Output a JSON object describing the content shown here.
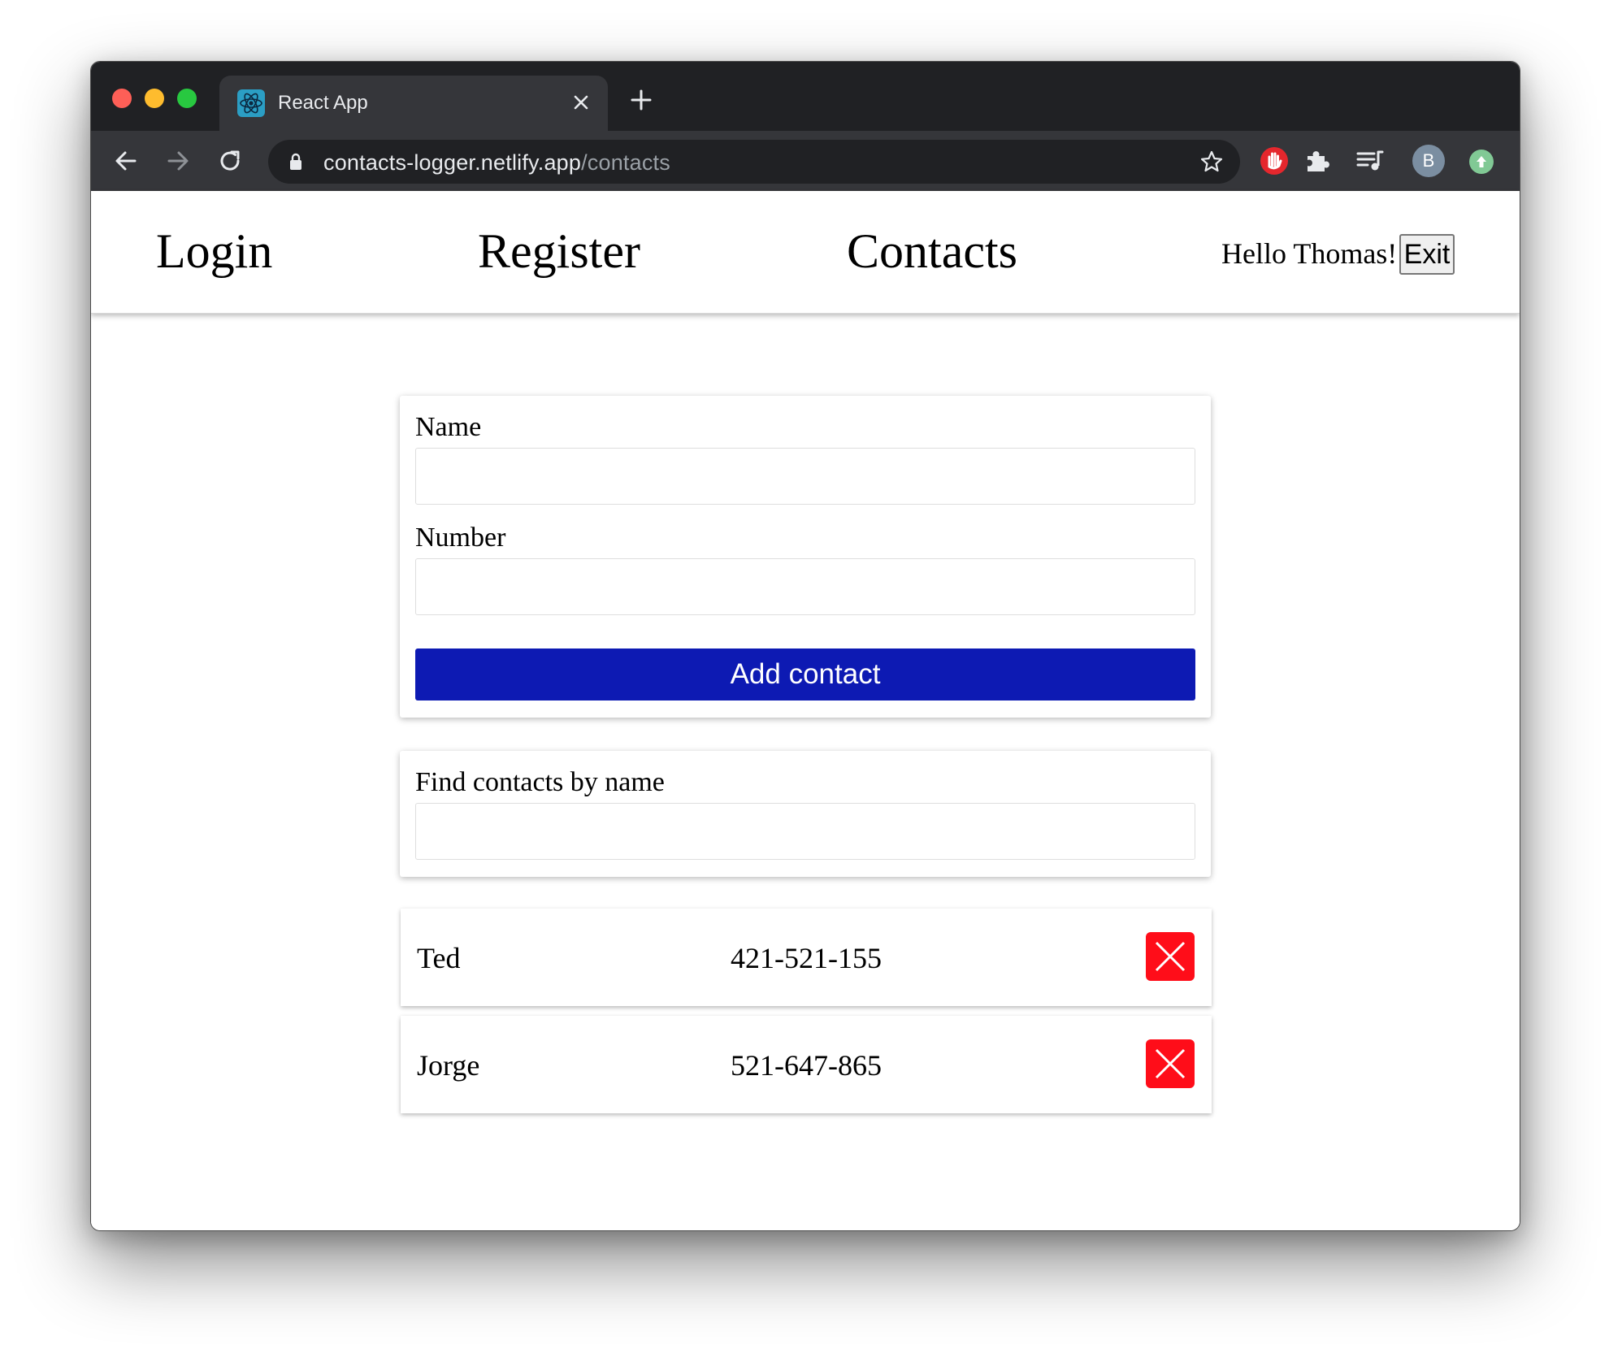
{
  "browser": {
    "tab_title": "React App",
    "url_host": "contacts-logger.netlify.app",
    "url_path": "/contacts",
    "profile_initial": "B"
  },
  "icons": {
    "tab_favicon": "react-icon",
    "tab_close": "close-icon",
    "new_tab": "plus-icon",
    "back": "arrow-left-icon",
    "forward": "arrow-right-icon",
    "reload": "reload-icon",
    "lock": "lock-icon",
    "bookmark": "star-icon",
    "adblock": "hand-stop-icon",
    "extensions": "puzzle-icon",
    "media": "playlist-icon",
    "update": "arrow-up-icon",
    "delete": "close-x-icon"
  },
  "nav": {
    "login": "Login",
    "register": "Register",
    "contacts": "Contacts",
    "greeting": "Hello Thomas!",
    "exit": "Exit"
  },
  "form": {
    "name_label": "Name",
    "name_value": "",
    "number_label": "Number",
    "number_value": "",
    "submit_label": "Add contact"
  },
  "filter": {
    "label": "Find contacts by name",
    "value": ""
  },
  "contacts": [
    {
      "name": "Ted",
      "number": "421-521-155"
    },
    {
      "name": "Jorge",
      "number": "521-647-865"
    }
  ],
  "colors": {
    "primary_button": "#0d1ab3",
    "delete_button": "#ff0d19"
  }
}
